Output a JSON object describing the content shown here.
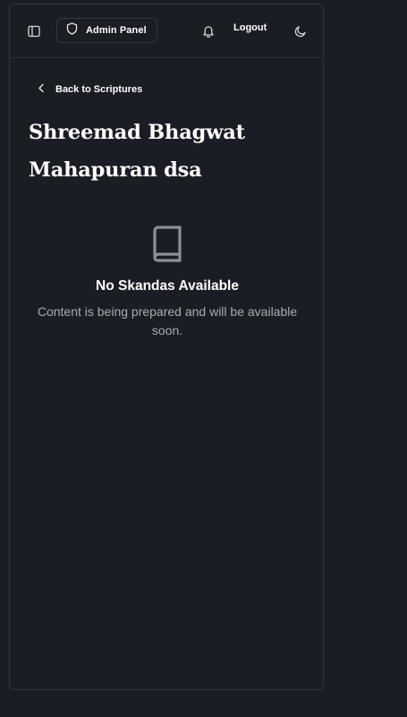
{
  "topbar": {
    "sidebar_toggle_icon": "sidebar-panel-icon",
    "admin_panel_label": "Admin Panel",
    "admin_panel_icon": "shield-icon",
    "notifications_icon": "bell-icon",
    "logout_label": "Logout",
    "theme_icon": "moon-icon"
  },
  "navigation": {
    "back_label": "Back to Scriptures",
    "back_icon": "chevron-left-icon"
  },
  "page": {
    "title": "Shreemad Bhagwat Mahapuran dsa"
  },
  "empty_state": {
    "icon": "book-icon",
    "title": "No Skandas Available",
    "description": "Content is being prepared and will be available soon."
  },
  "colors": {
    "background": "#1a1d24",
    "border": "#34373f",
    "text_primary": "#ffffff",
    "text_muted": "#a9abb1"
  }
}
